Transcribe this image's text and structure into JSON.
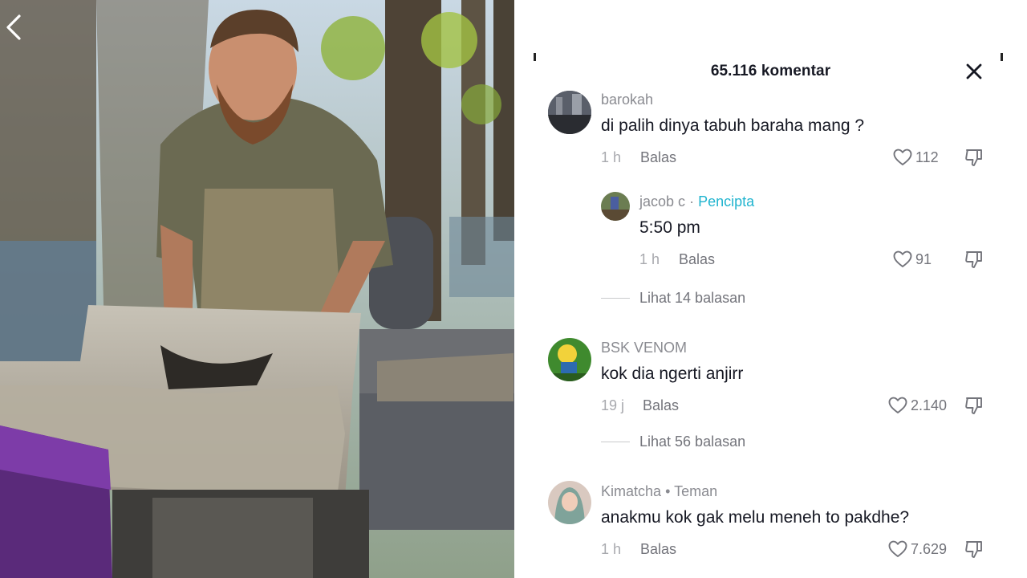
{
  "header": {
    "title": "65.116 komentar"
  },
  "comments": [
    {
      "username": "barokah",
      "text": "di palih dinya tabuh baraha mang ?",
      "time": "1 h",
      "reply_label": "Balas",
      "likes": "112",
      "replies": [
        {
          "username": "jacob c",
          "separator": "·",
          "badge": "Pencipta",
          "text": "5:50 pm",
          "time": "1 h",
          "reply_label": "Balas",
          "likes": "91"
        }
      ],
      "view_replies": "Lihat 14 balasan"
    },
    {
      "username": "BSK VENOM",
      "text": "kok dia ngerti anjirr",
      "time": "19 j",
      "reply_label": "Balas",
      "likes": "2.140",
      "view_replies": "Lihat 56 balasan"
    },
    {
      "username": "Kimatcha",
      "separator": "•",
      "badge": "Teman",
      "text": "anakmu kok gak melu meneh to pakdhe?",
      "time": "1 h",
      "reply_label": "Balas",
      "likes": "7.629"
    }
  ],
  "icons": {
    "back": "chevron-left-icon",
    "close": "close-icon",
    "like": "heart-outline-icon",
    "dislike": "thumbs-down-icon"
  },
  "colors": {
    "creator_badge": "#20b4cf",
    "text": "#161823",
    "muted": "#8a8b91"
  }
}
